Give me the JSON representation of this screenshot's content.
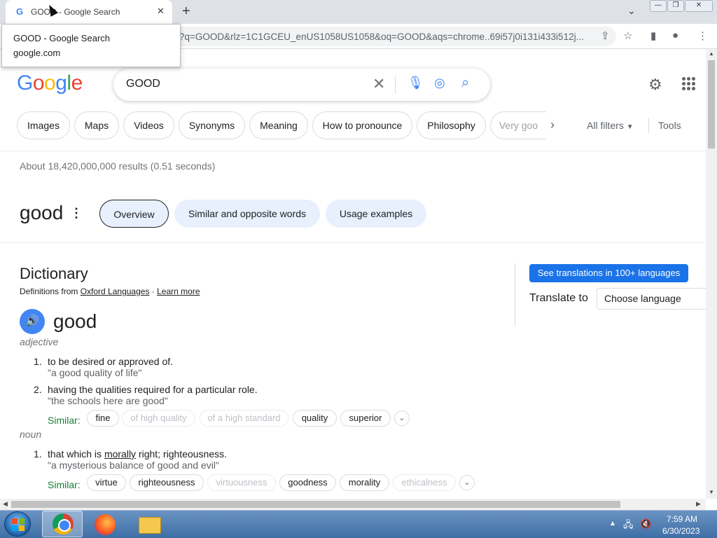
{
  "browser": {
    "tab_title": "GOOD - Google Search",
    "favicon": "G",
    "new_tab": "+",
    "close": "✕",
    "tab_menu": "⌄",
    "url": "?q=GOOD&rlz=1C1GCEU_enUS1058US1058&oq=GOOD&aqs=chrome..69i57j0i131i433i512j...",
    "win_min": "—",
    "win_max": "❐",
    "win_close": "✕"
  },
  "tooltip": {
    "title": "GOOD - Google Search",
    "domain": "google.com"
  },
  "header": {
    "logo": [
      "G",
      "o",
      "o",
      "g",
      "l",
      "e"
    ],
    "logo_colors": [
      "#4285f4",
      "#ea4335",
      "#fbbc05",
      "#4285f4",
      "#34a853",
      "#ea4335"
    ],
    "query": "GOOD"
  },
  "chips": [
    "Images",
    "Maps",
    "Videos",
    "Synonyms",
    "Meaning",
    "How to pronounce",
    "Philosophy",
    "Very goo"
  ],
  "filters": {
    "all_filters": "All filters",
    "tools": "Tools"
  },
  "stats": "About 18,420,000,000 results (0.51 seconds)",
  "word_tabs": {
    "word": "good",
    "tabs": [
      "Overview",
      "Similar and opposite words",
      "Usage examples"
    ]
  },
  "dictionary": {
    "title": "Dictionary",
    "source_prefix": "Definitions from ",
    "source": "Oxford Languages",
    "separator": " · ",
    "learn_more": "Learn more",
    "headword": "good",
    "pos1": "adjective",
    "adj_defs": [
      {
        "num": "1.",
        "def": "to be desired or approved of.",
        "ex": "\"a good quality of life\""
      },
      {
        "num": "2.",
        "def": "having the qualities required for a particular role.",
        "ex": "\"the schools here are good\""
      }
    ],
    "similar_label": "Similar:",
    "adj_similar": [
      "fine",
      "of high quality",
      "of a high standard",
      "quality",
      "superior"
    ],
    "pos2": "noun",
    "noun_def": {
      "num": "1.",
      "pre": "that which is ",
      "link": "morally",
      "post": " right; righteousness.",
      "ex": "\"a mysterious balance of good and evil\""
    },
    "noun_similar": [
      "virtue",
      "righteousness",
      "virtuousness",
      "goodness",
      "morality",
      "ethicalness"
    ]
  },
  "translate": {
    "button": "See translations in 100+ languages",
    "label": "Translate to",
    "select": "Choose language"
  },
  "taskbar": {
    "time": "7:59 AM",
    "date": "6/30/2023"
  },
  "colors": {
    "accent": "#1a73e8",
    "similar_green": "#188038",
    "chip_active_bg": "#e8f0fe"
  }
}
